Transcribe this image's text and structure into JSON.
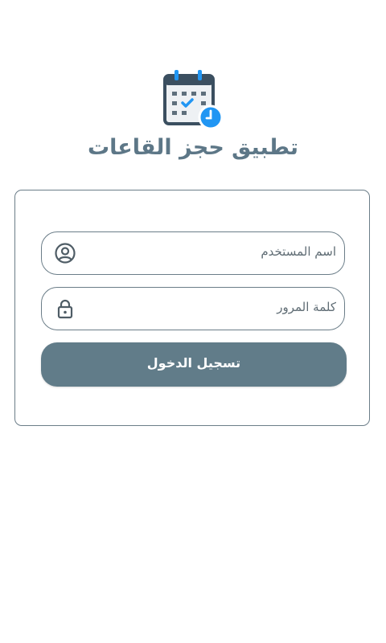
{
  "app": {
    "title": "تطبيق حجز القاعات",
    "logo_icon": "calendar-clock-icon"
  },
  "login": {
    "username_placeholder": "اسم المستخدم",
    "username_value": "",
    "username_icon": "user-circle-icon",
    "password_placeholder": "كلمة المرور",
    "password_value": "",
    "password_icon": "lock-icon",
    "submit_label": "تسجيل الدخول"
  },
  "colors": {
    "primary": "#617c89",
    "title": "#5d7787",
    "border": "#6b7d88",
    "accent_clock": "#2196f3",
    "calendar_dark": "#3b4f60"
  }
}
